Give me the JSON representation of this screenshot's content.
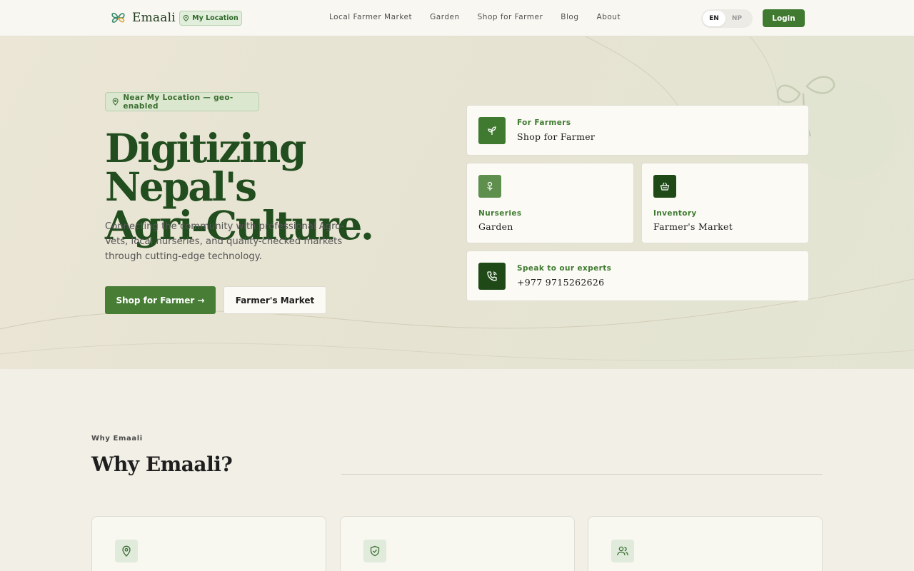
{
  "nav": {
    "brand": "Emaali",
    "location_pill": "My Location",
    "links": [
      "Local Farmer Market",
      "Garden",
      "Shop for Farmer",
      "Blog",
      "About"
    ],
    "languages": [
      "EN",
      "NP"
    ],
    "active_language": "EN",
    "login_label": "Login"
  },
  "hero": {
    "badge": "Near My Location — geo-enabled",
    "title_line1": "Digitizing Nepal's",
    "title_line2": "Agri-Culture.",
    "subtitle": "Connecting the community with professional Agro-Vets, local nurseries, and quality-checked markets through cutting-edge technology.",
    "primary_cta": "Shop for Farmer →",
    "secondary_cta": "Farmer's Market"
  },
  "cards": [
    {
      "kicker": "For Farmers",
      "title": "Shop for Farmer",
      "icon": "sprout-icon"
    },
    {
      "kicker": "Nurseries",
      "title": "Garden",
      "icon": "flower-icon"
    },
    {
      "kicker": "Inventory",
      "title": "Farmer's Market",
      "icon": "basket-icon"
    },
    {
      "kicker": "Speak to our experts",
      "title": "+977 9715262626",
      "icon": "phone-icon"
    }
  ],
  "why": {
    "kicker": "Why Emaali",
    "title": "Why Emaali?",
    "feature_icons": [
      "map-pin-icon",
      "shield-check-icon",
      "users-icon"
    ]
  },
  "colors": {
    "brand_green": "#3f7a30",
    "dark_green": "#224d1e",
    "hero_bg": "#e8e4d4",
    "page_bg": "#f2efe6"
  }
}
